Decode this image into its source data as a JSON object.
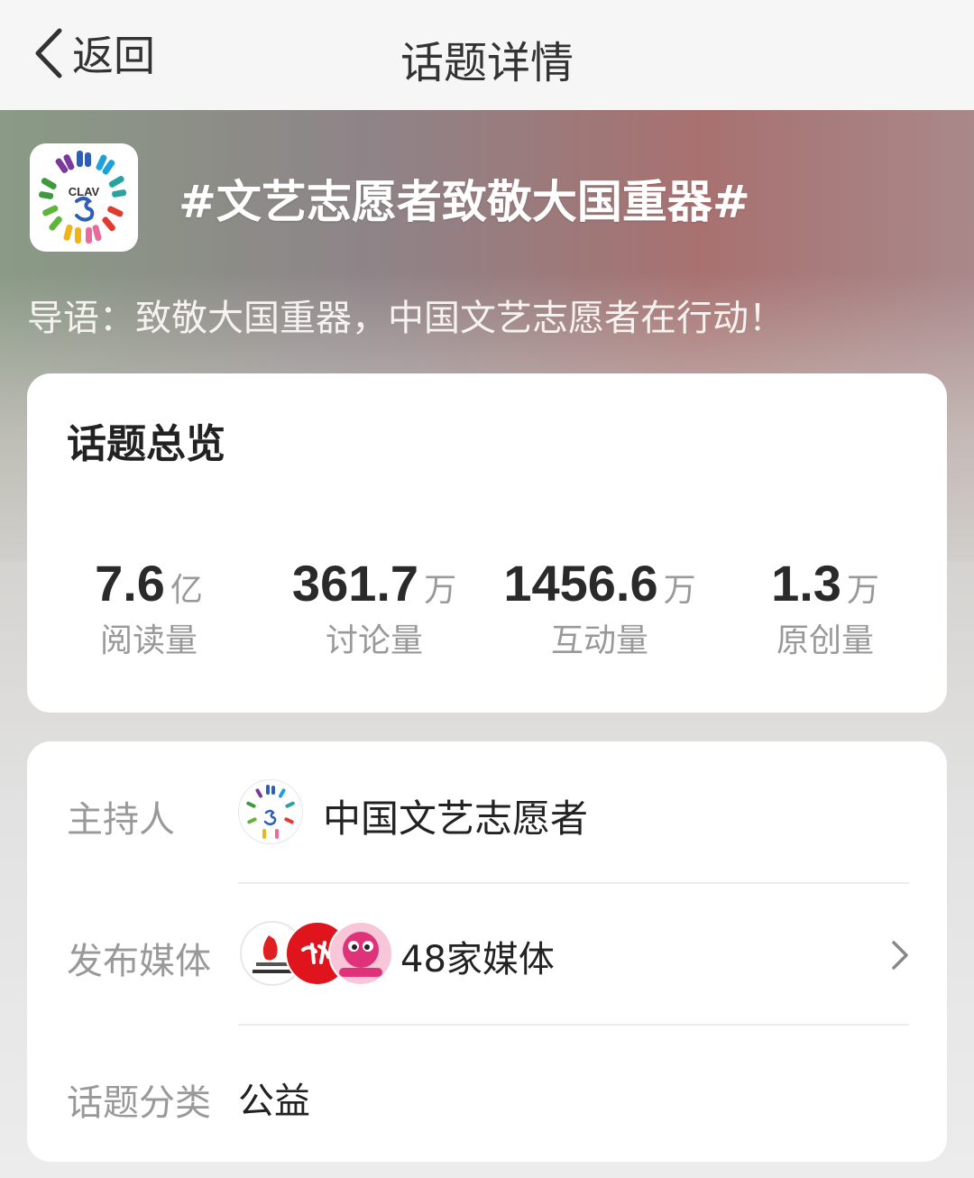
{
  "nav": {
    "back_label": "返回",
    "title": "话题详情"
  },
  "topic": {
    "logo_text": "CLAV",
    "title": "#文艺志愿者致敬大国重器#",
    "intro": "导语：致敬大国重器，中国文艺志愿者在行动！"
  },
  "overview": {
    "title": "话题总览",
    "stats": [
      {
        "value": "7.6",
        "unit": "亿",
        "label": "阅读量"
      },
      {
        "value": "361.7",
        "unit": "万",
        "label": "讨论量"
      },
      {
        "value": "1456.6",
        "unit": "万",
        "label": "互动量"
      },
      {
        "value": "1.3",
        "unit": "万",
        "label": "原创量"
      }
    ]
  },
  "info": {
    "host_label": "主持人",
    "host_name": "中国文艺志愿者",
    "media_label": "发布媒体",
    "media_count": "48家媒体",
    "category_label": "话题分类",
    "category_value": "公益"
  },
  "icons": {
    "back": "chevron-left-icon",
    "media_more": "chevron-right-icon"
  }
}
